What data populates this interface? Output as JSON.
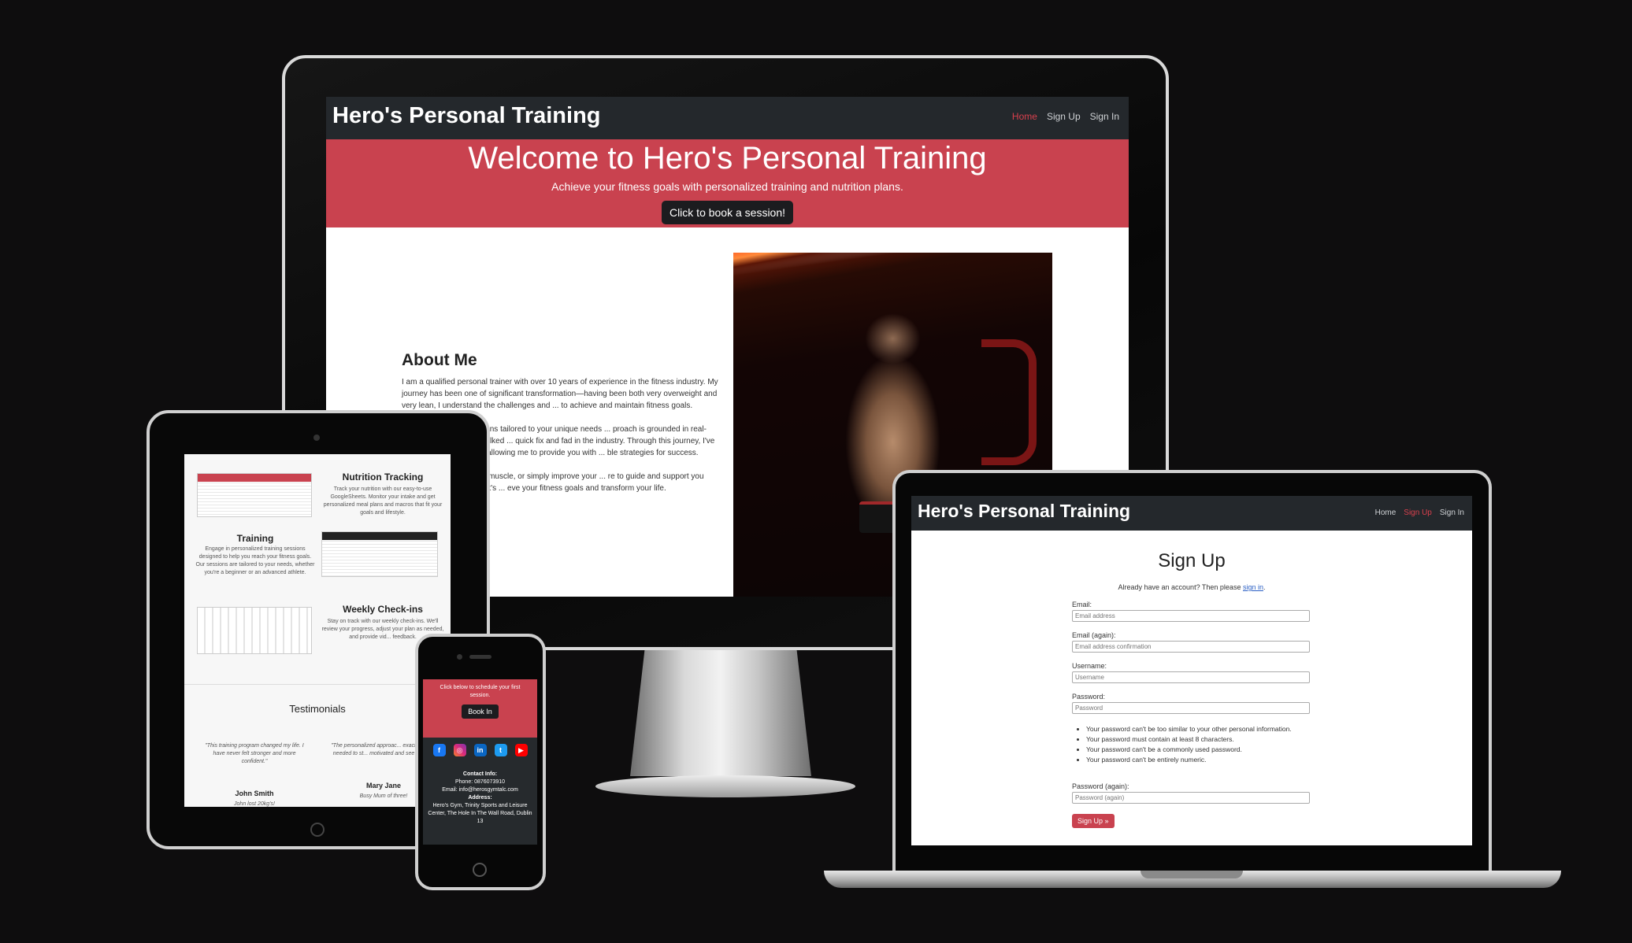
{
  "desktop": {
    "brand": "Hero's Personal Training",
    "nav": [
      "Home",
      "Sign Up",
      "Sign In"
    ],
    "hero_title": "Welcome to Hero's Personal Training",
    "hero_subtitle": "Achieve your fitness goals with personalized training and nutrition plans.",
    "hero_button": "Click to book a session!",
    "about_title": "About Me",
    "about_p1": "I am a qualified personal trainer with over 10 years of experience in the fitness industry. My journey has been one of significant transformation—having been both very overweight and very lean, I understand the challenges and ... to achieve and maintain fitness goals.",
    "about_p2": "... aining and nutrition plans tailored to your unique needs ... proach is grounded in real-world experience; I've walked ... quick fix and fad in the industry. Through this journey, I've ... rks and what doesn't, allowing me to provide you with ... ble strategies for success.",
    "about_p3": "... g to lose weight, build muscle, or simply improve your ... re to guide and support you every step of the way. Let's ... eve your fitness goals and transform your life."
  },
  "tablet": {
    "nutrition_title": "Nutrition Tracking",
    "nutrition_text": "Track your nutrition with our easy-to-use GoogleSheets. Monitor your intake and get personalized meal plans and macros that fit your goals and lifestyle.",
    "training_title": "Training",
    "training_text": "Engage in personalized training sessions designed to help you reach your fitness goals. Our sessions are tailored to your needs, whether you're a beginner or an advanced athlete.",
    "checkins_title": "Weekly Check-ins",
    "checkins_text": "Stay on track with our weekly check-ins. We'll review your progress, adjust your plan as needed, and provide vid... feedback.",
    "testimonials_title": "Testimonials",
    "quote1": "\"This training program changed my life. I have never felt stronger and more confident.\"",
    "author1": "John Smith",
    "author1_note": "John lost 20kg's!",
    "quote2": "\"The personalized approac... exactly what I needed to st... motivated and see result...",
    "author2": "Mary Jane",
    "author2_note": "Busy Mum of three!"
  },
  "phone": {
    "cta_text": "Click below to schedule your first session.",
    "cta_button": "Book In",
    "social": [
      "facebook-icon",
      "instagram-icon",
      "linkedin-icon",
      "twitter-icon",
      "youtube-icon"
    ],
    "contact_label": "Contact Info:",
    "phone_line": "Phone: 0876073910",
    "email_line": "Email: info@herosgymtalc.com",
    "address_label": "Address:",
    "address": "Hero's Gym, Trinity Sports and Leisure Center, The Hole In The Wall Road, Dublin 13"
  },
  "laptop": {
    "brand": "Hero's Personal Training",
    "nav": [
      "Home",
      "Sign Up",
      "Sign In"
    ],
    "title": "Sign Up",
    "already_text": "Already have an account? Then please",
    "sign_in_link": "sign in",
    "email_label": "Email:",
    "email_placeholder": "Email address",
    "email2_label": "Email (again):",
    "email2_placeholder": "Email address confirmation",
    "username_label": "Username:",
    "username_placeholder": "Username",
    "password_label": "Password:",
    "password_placeholder": "Password",
    "hints": [
      "Your password can't be too similar to your other personal information.",
      "Your password must contain at least 8 characters.",
      "Your password can't be a commonly used password.",
      "Your password can't be entirely numeric."
    ],
    "password2_label": "Password (again):",
    "password2_placeholder": "Password (again)",
    "submit": "Sign Up »"
  },
  "colors": {
    "accent": "#c9424f",
    "nav": "#24282c",
    "background": "#0e0d0e"
  }
}
